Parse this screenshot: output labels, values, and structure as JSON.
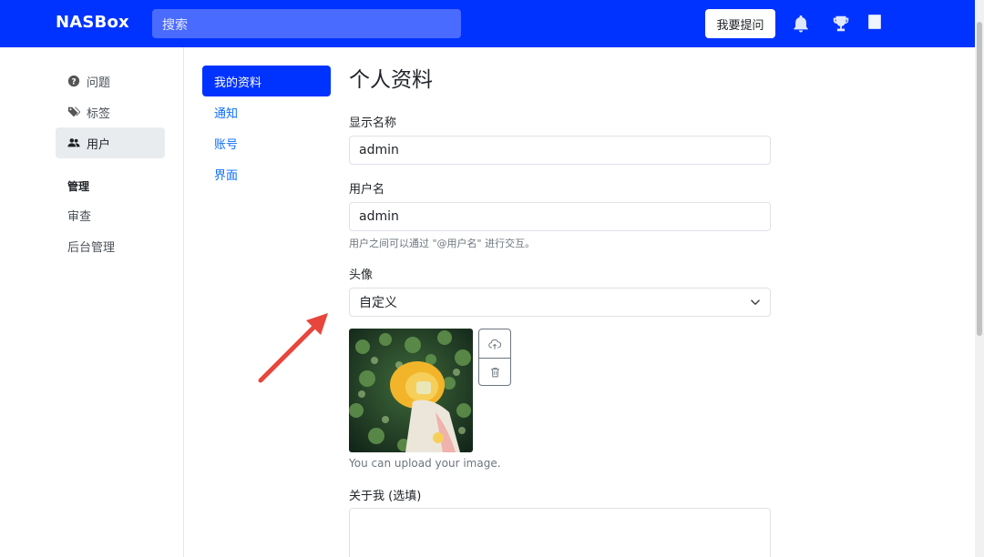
{
  "header": {
    "brand": "NASBox",
    "search_placeholder": "搜索",
    "ask_button": "我要提问"
  },
  "sidebar": {
    "items": [
      {
        "label": "问题",
        "icon": "question-circle-icon"
      },
      {
        "label": "标签",
        "icon": "tags-icon"
      },
      {
        "label": "用户",
        "icon": "people-icon",
        "active": true
      }
    ],
    "section_title": "管理",
    "admin_items": [
      {
        "label": "审查"
      },
      {
        "label": "后台管理"
      }
    ]
  },
  "settings_nav": {
    "items": [
      {
        "label": "我的资料",
        "active": true
      },
      {
        "label": "通知"
      },
      {
        "label": "账号"
      },
      {
        "label": "界面"
      }
    ]
  },
  "profile_form": {
    "title": "个人资料",
    "display_name_label": "显示名称",
    "display_name_value": "admin",
    "username_label": "用户名",
    "username_value": "admin",
    "username_help": "用户之间可以通过 \"@用户名\" 进行交互。",
    "avatar_label": "头像",
    "avatar_select_value": "自定义",
    "avatar_help": "You can upload your image.",
    "about_label": "关于我 (选填)",
    "about_value": ""
  },
  "colors": {
    "brand_blue": "#0033ff",
    "link_blue": "#0d6efd",
    "annotation_arrow": "#e8463c"
  }
}
